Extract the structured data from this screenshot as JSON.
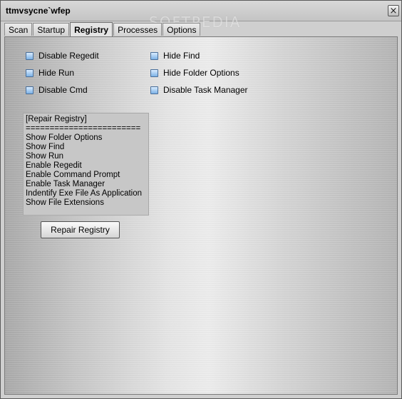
{
  "window": {
    "title": "ttmvsycne`wfep",
    "watermark": "SOFTPEDIA",
    "close_glyph": "×"
  },
  "tabs": [
    {
      "label": "Scan"
    },
    {
      "label": "Startup"
    },
    {
      "label": "Registry",
      "active": true
    },
    {
      "label": "Processes"
    },
    {
      "label": "Options"
    }
  ],
  "checkboxes": {
    "left": [
      {
        "label": "Disable Regedit",
        "checked": false
      },
      {
        "label": "Hide Run",
        "checked": false
      },
      {
        "label": "Disable Cmd",
        "checked": false
      }
    ],
    "right": [
      {
        "label": "Hide Find",
        "checked": false
      },
      {
        "label": "Hide Folder Options",
        "checked": false
      },
      {
        "label": "Disable Task Manager",
        "checked": false
      }
    ]
  },
  "repair_list": {
    "header": "[Repair Registry]",
    "separator": "========================",
    "items": [
      "Show Folder Options",
      "Show Find",
      "Show Run",
      "Enable Regedit",
      "Enable Command Prompt",
      "Enable Task Manager",
      "Indentify Exe File As Application",
      "Show File Extensions"
    ]
  },
  "repair_button": {
    "label": "Repair Registry"
  },
  "icons": {
    "close": "close-icon",
    "checkbox": "checkbox-icon"
  }
}
